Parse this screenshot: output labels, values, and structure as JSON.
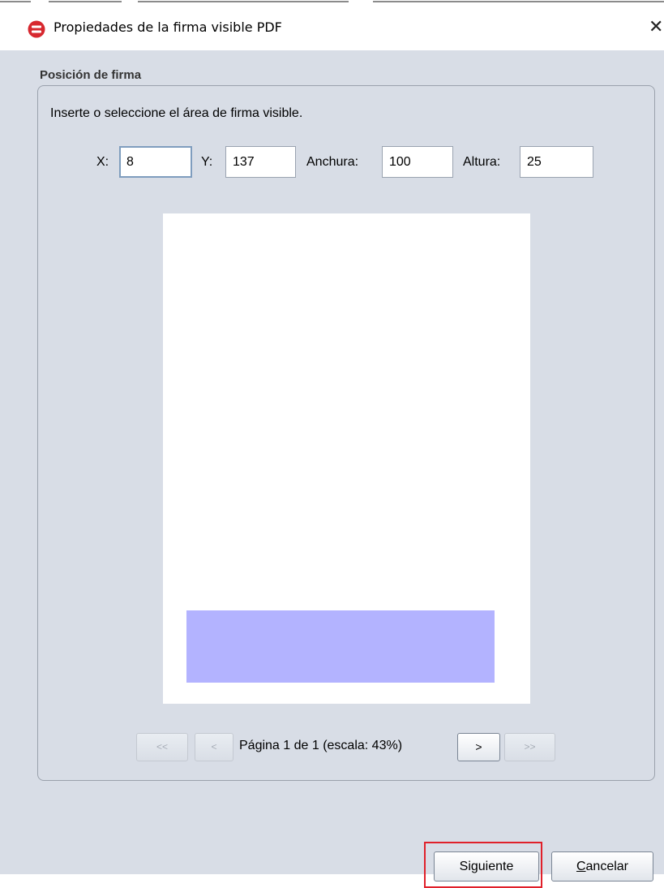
{
  "window": {
    "title": "Propiedades de la firma visible PDF",
    "icon": "autofirma-app-icon",
    "close_glyph": "✕",
    "accent_color": "#d7282f"
  },
  "group": {
    "title": "Posición de firma",
    "instruction": "Inserte o seleccione el área de firma visible."
  },
  "fields": {
    "x": {
      "label": "X:",
      "value": "8"
    },
    "y": {
      "label": "Y:",
      "value": "137"
    },
    "width": {
      "label": "Anchura:",
      "value": "100"
    },
    "height": {
      "label": "Altura:",
      "value": "25"
    }
  },
  "preview": {
    "page_color": "#ffffff",
    "signature_area_color": "#b3b3ff"
  },
  "pagination": {
    "first_label": "<<",
    "prev_label": "<",
    "status": "Página 1 de 1 (escala: 43%)",
    "next_label": ">",
    "last_label": ">>"
  },
  "buttons": {
    "next_label": "Siguiente",
    "cancel_label_mnemonic": "C",
    "cancel_label_rest": "ancelar",
    "highlight_color": "#e0202a"
  }
}
